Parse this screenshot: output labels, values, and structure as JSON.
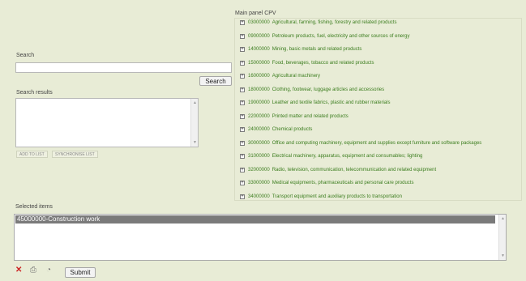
{
  "search": {
    "label": "Search",
    "value": "",
    "button": "Search"
  },
  "results": {
    "label": "Search results",
    "add_to_list": "ADD TO LIST",
    "sync_list": "SYNCHRONISE LIST"
  },
  "main_panel": {
    "title": "Main panel CPV",
    "items": [
      {
        "code": "03000000",
        "text": "Agricultural, farming, fishing, forestry and related products"
      },
      {
        "code": "09000000",
        "text": "Petroleum products, fuel, electricity and other sources of energy"
      },
      {
        "code": "14000000",
        "text": "Mining, basic metals and related products"
      },
      {
        "code": "15000000",
        "text": "Food, beverages, tobacco and related products"
      },
      {
        "code": "16000000",
        "text": "Agricultural machinery"
      },
      {
        "code": "18000000",
        "text": "Clothing, footwear, luggage articles and accessories"
      },
      {
        "code": "19000000",
        "text": "Leather and textile fabrics, plastic and rubber materials"
      },
      {
        "code": "22000000",
        "text": "Printed matter and related products"
      },
      {
        "code": "24000000",
        "text": "Chemical products"
      },
      {
        "code": "30000000",
        "text": "Office and computing machinery, equipment and supplies except furniture and software packages"
      },
      {
        "code": "31000000",
        "text": "Electrical machinery, apparatus, equipment and consumables; lighting"
      },
      {
        "code": "32000000",
        "text": "Radio, television, communication, telecommunication and related equipment"
      },
      {
        "code": "33000000",
        "text": "Medical equipments, pharmaceuticals and personal care products"
      },
      {
        "code": "34000000",
        "text": "Transport equipment and auxiliary products to transportation"
      }
    ]
  },
  "selected": {
    "label": "Selected items",
    "items": [
      "45000000-Construction work"
    ]
  },
  "footer": {
    "submit": "Submit"
  },
  "colors": {
    "background": "#e8ecd6",
    "link": "#3b7d1e",
    "selected_row": "#7a7a7a",
    "delete": "#cc2222"
  },
  "icons": {
    "delete": "close-icon",
    "print": "print-icon",
    "view": "eye-icon"
  }
}
